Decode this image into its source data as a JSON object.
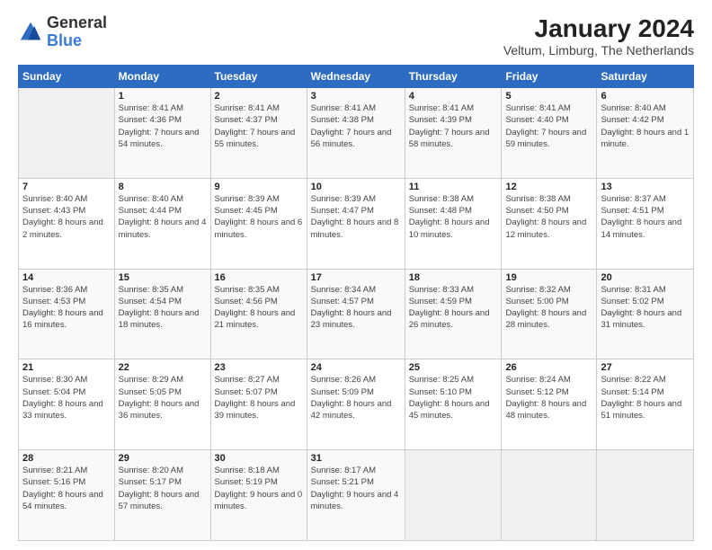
{
  "logo": {
    "line1": "General",
    "line2": "Blue"
  },
  "title": "January 2024",
  "subtitle": "Veltum, Limburg, The Netherlands",
  "days_of_week": [
    "Sunday",
    "Monday",
    "Tuesday",
    "Wednesday",
    "Thursday",
    "Friday",
    "Saturday"
  ],
  "weeks": [
    [
      {
        "day": "",
        "sunrise": "",
        "sunset": "",
        "daylight": ""
      },
      {
        "day": "1",
        "sunrise": "Sunrise: 8:41 AM",
        "sunset": "Sunset: 4:36 PM",
        "daylight": "Daylight: 7 hours and 54 minutes."
      },
      {
        "day": "2",
        "sunrise": "Sunrise: 8:41 AM",
        "sunset": "Sunset: 4:37 PM",
        "daylight": "Daylight: 7 hours and 55 minutes."
      },
      {
        "day": "3",
        "sunrise": "Sunrise: 8:41 AM",
        "sunset": "Sunset: 4:38 PM",
        "daylight": "Daylight: 7 hours and 56 minutes."
      },
      {
        "day": "4",
        "sunrise": "Sunrise: 8:41 AM",
        "sunset": "Sunset: 4:39 PM",
        "daylight": "Daylight: 7 hours and 58 minutes."
      },
      {
        "day": "5",
        "sunrise": "Sunrise: 8:41 AM",
        "sunset": "Sunset: 4:40 PM",
        "daylight": "Daylight: 7 hours and 59 minutes."
      },
      {
        "day": "6",
        "sunrise": "Sunrise: 8:40 AM",
        "sunset": "Sunset: 4:42 PM",
        "daylight": "Daylight: 8 hours and 1 minute."
      }
    ],
    [
      {
        "day": "7",
        "sunrise": "Sunrise: 8:40 AM",
        "sunset": "Sunset: 4:43 PM",
        "daylight": "Daylight: 8 hours and 2 minutes."
      },
      {
        "day": "8",
        "sunrise": "Sunrise: 8:40 AM",
        "sunset": "Sunset: 4:44 PM",
        "daylight": "Daylight: 8 hours and 4 minutes."
      },
      {
        "day": "9",
        "sunrise": "Sunrise: 8:39 AM",
        "sunset": "Sunset: 4:45 PM",
        "daylight": "Daylight: 8 hours and 6 minutes."
      },
      {
        "day": "10",
        "sunrise": "Sunrise: 8:39 AM",
        "sunset": "Sunset: 4:47 PM",
        "daylight": "Daylight: 8 hours and 8 minutes."
      },
      {
        "day": "11",
        "sunrise": "Sunrise: 8:38 AM",
        "sunset": "Sunset: 4:48 PM",
        "daylight": "Daylight: 8 hours and 10 minutes."
      },
      {
        "day": "12",
        "sunrise": "Sunrise: 8:38 AM",
        "sunset": "Sunset: 4:50 PM",
        "daylight": "Daylight: 8 hours and 12 minutes."
      },
      {
        "day": "13",
        "sunrise": "Sunrise: 8:37 AM",
        "sunset": "Sunset: 4:51 PM",
        "daylight": "Daylight: 8 hours and 14 minutes."
      }
    ],
    [
      {
        "day": "14",
        "sunrise": "Sunrise: 8:36 AM",
        "sunset": "Sunset: 4:53 PM",
        "daylight": "Daylight: 8 hours and 16 minutes."
      },
      {
        "day": "15",
        "sunrise": "Sunrise: 8:35 AM",
        "sunset": "Sunset: 4:54 PM",
        "daylight": "Daylight: 8 hours and 18 minutes."
      },
      {
        "day": "16",
        "sunrise": "Sunrise: 8:35 AM",
        "sunset": "Sunset: 4:56 PM",
        "daylight": "Daylight: 8 hours and 21 minutes."
      },
      {
        "day": "17",
        "sunrise": "Sunrise: 8:34 AM",
        "sunset": "Sunset: 4:57 PM",
        "daylight": "Daylight: 8 hours and 23 minutes."
      },
      {
        "day": "18",
        "sunrise": "Sunrise: 8:33 AM",
        "sunset": "Sunset: 4:59 PM",
        "daylight": "Daylight: 8 hours and 26 minutes."
      },
      {
        "day": "19",
        "sunrise": "Sunrise: 8:32 AM",
        "sunset": "Sunset: 5:00 PM",
        "daylight": "Daylight: 8 hours and 28 minutes."
      },
      {
        "day": "20",
        "sunrise": "Sunrise: 8:31 AM",
        "sunset": "Sunset: 5:02 PM",
        "daylight": "Daylight: 8 hours and 31 minutes."
      }
    ],
    [
      {
        "day": "21",
        "sunrise": "Sunrise: 8:30 AM",
        "sunset": "Sunset: 5:04 PM",
        "daylight": "Daylight: 8 hours and 33 minutes."
      },
      {
        "day": "22",
        "sunrise": "Sunrise: 8:29 AM",
        "sunset": "Sunset: 5:05 PM",
        "daylight": "Daylight: 8 hours and 36 minutes."
      },
      {
        "day": "23",
        "sunrise": "Sunrise: 8:27 AM",
        "sunset": "Sunset: 5:07 PM",
        "daylight": "Daylight: 8 hours and 39 minutes."
      },
      {
        "day": "24",
        "sunrise": "Sunrise: 8:26 AM",
        "sunset": "Sunset: 5:09 PM",
        "daylight": "Daylight: 8 hours and 42 minutes."
      },
      {
        "day": "25",
        "sunrise": "Sunrise: 8:25 AM",
        "sunset": "Sunset: 5:10 PM",
        "daylight": "Daylight: 8 hours and 45 minutes."
      },
      {
        "day": "26",
        "sunrise": "Sunrise: 8:24 AM",
        "sunset": "Sunset: 5:12 PM",
        "daylight": "Daylight: 8 hours and 48 minutes."
      },
      {
        "day": "27",
        "sunrise": "Sunrise: 8:22 AM",
        "sunset": "Sunset: 5:14 PM",
        "daylight": "Daylight: 8 hours and 51 minutes."
      }
    ],
    [
      {
        "day": "28",
        "sunrise": "Sunrise: 8:21 AM",
        "sunset": "Sunset: 5:16 PM",
        "daylight": "Daylight: 8 hours and 54 minutes."
      },
      {
        "day": "29",
        "sunrise": "Sunrise: 8:20 AM",
        "sunset": "Sunset: 5:17 PM",
        "daylight": "Daylight: 8 hours and 57 minutes."
      },
      {
        "day": "30",
        "sunrise": "Sunrise: 8:18 AM",
        "sunset": "Sunset: 5:19 PM",
        "daylight": "Daylight: 9 hours and 0 minutes."
      },
      {
        "day": "31",
        "sunrise": "Sunrise: 8:17 AM",
        "sunset": "Sunset: 5:21 PM",
        "daylight": "Daylight: 9 hours and 4 minutes."
      },
      {
        "day": "",
        "sunrise": "",
        "sunset": "",
        "daylight": ""
      },
      {
        "day": "",
        "sunrise": "",
        "sunset": "",
        "daylight": ""
      },
      {
        "day": "",
        "sunrise": "",
        "sunset": "",
        "daylight": ""
      }
    ]
  ]
}
